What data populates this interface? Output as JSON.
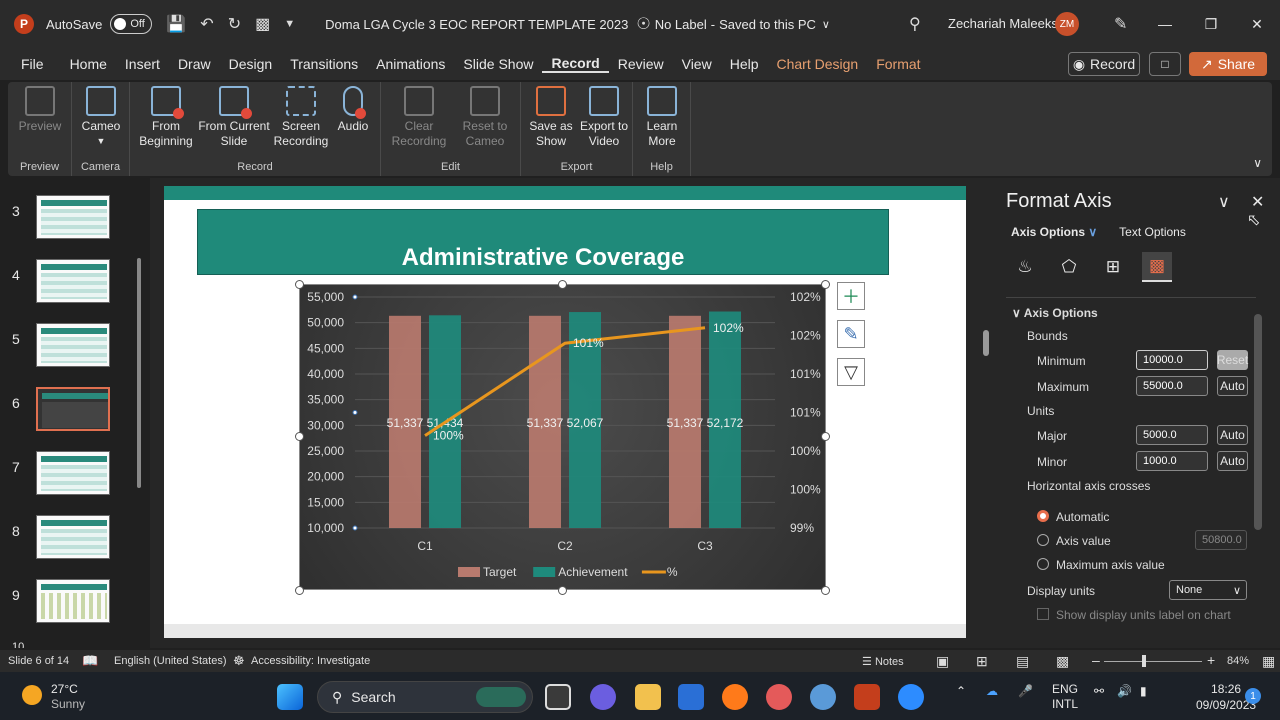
{
  "titlebar": {
    "app_logo": "P",
    "autosave_label": "AutoSave",
    "autosave_state": "Off",
    "doc_title": "Doma LGA Cycle 3 EOC REPORT TEMPLATE 2023",
    "label_status": "No Label",
    "save_status": "Saved to this PC",
    "user_name": "Zechariah Maleeks",
    "user_initials": "ZM"
  },
  "menu": {
    "tabs": [
      "File",
      "Home",
      "Insert",
      "Draw",
      "Design",
      "Transitions",
      "Animations",
      "Slide Show",
      "Record",
      "Review",
      "View",
      "Help",
      "Chart Design",
      "Format"
    ],
    "active": "Record",
    "record_button": "Record",
    "share_button": "Share"
  },
  "ribbon": {
    "groups": [
      {
        "label": "Preview",
        "buttons": [
          "Preview"
        ]
      },
      {
        "label": "Camera",
        "buttons": [
          "Cameo"
        ]
      },
      {
        "label": "Record",
        "buttons": [
          "From Beginning",
          "From Current Slide",
          "Screen Recording",
          "Audio"
        ]
      },
      {
        "label": "Edit",
        "buttons": [
          "Clear Recording",
          "Reset to Cameo"
        ]
      },
      {
        "label": "Export",
        "buttons": [
          "Save as Show",
          "Export to Video"
        ]
      },
      {
        "label": "Help",
        "buttons": [
          "Learn More"
        ]
      }
    ]
  },
  "thumbnails": {
    "numbers": [
      "3",
      "4",
      "5",
      "6",
      "7",
      "8",
      "9",
      "10"
    ],
    "selected": "6"
  },
  "slide": {
    "title": "Administrative Coverage"
  },
  "chart_data": {
    "type": "bar",
    "categories": [
      "C1",
      "C2",
      "C3"
    ],
    "series": [
      {
        "name": "Target",
        "values": [
          51337,
          51337,
          51337
        ],
        "color": "#b87a6e",
        "labels": [
          "51,337",
          "51,337",
          "51,337"
        ]
      },
      {
        "name": "Achievement",
        "values": [
          51434,
          52067,
          52172
        ],
        "color": "#1e8a7c",
        "labels": [
          "51,434",
          "52,067",
          "52,172"
        ]
      },
      {
        "name": "%",
        "type": "line",
        "axis": "secondary",
        "values": [
          100.2,
          101.4,
          101.6
        ],
        "color": "#e8961e",
        "labels": [
          "100%",
          "101%",
          "102%"
        ]
      }
    ],
    "y_ticks": [
      "55,000",
      "50,000",
      "45,000",
      "40,000",
      "35,000",
      "30,000",
      "25,000",
      "20,000",
      "15,000",
      "10,000"
    ],
    "ylim": [
      10000,
      55000
    ],
    "y2_ticks": [
      "102%",
      "102%",
      "101%",
      "101%",
      "100%",
      "100%",
      "99%"
    ],
    "y2lim": [
      99,
      102
    ],
    "legend_position": "bottom",
    "grid": true
  },
  "format_pane": {
    "title": "Format Axis",
    "tab_axis": "Axis Options",
    "tab_text": "Text Options",
    "section": "Axis Options",
    "bounds_label": "Bounds",
    "minimum_label": "Minimum",
    "minimum_value": "10000.0",
    "minimum_btn": "Reset",
    "maximum_label": "Maximum",
    "maximum_value": "55000.0",
    "maximum_btn": "Auto",
    "units_label": "Units",
    "major_label": "Major",
    "major_value": "5000.0",
    "major_btn": "Auto",
    "minor_label": "Minor",
    "minor_value": "1000.0",
    "minor_btn": "Auto",
    "crosses_label": "Horizontal axis crosses",
    "opt_auto": "Automatic",
    "opt_value": "Axis value",
    "opt_value_input": "50800.0",
    "opt_max": "Maximum axis value",
    "display_units_label": "Display units",
    "display_units_value": "None",
    "show_units_label": "Show display units label on chart"
  },
  "statusbar": {
    "slide_info": "Slide 6 of 14",
    "language": "English (United States)",
    "accessibility": "Accessibility: Investigate",
    "notes": "Notes",
    "zoom": "84%"
  },
  "taskbar": {
    "temp": "27°C",
    "weather": "Sunny",
    "search": "Search",
    "lang1": "ENG",
    "lang2": "INTL",
    "time": "18:26",
    "date": "09/09/2023",
    "notifications": "1"
  }
}
